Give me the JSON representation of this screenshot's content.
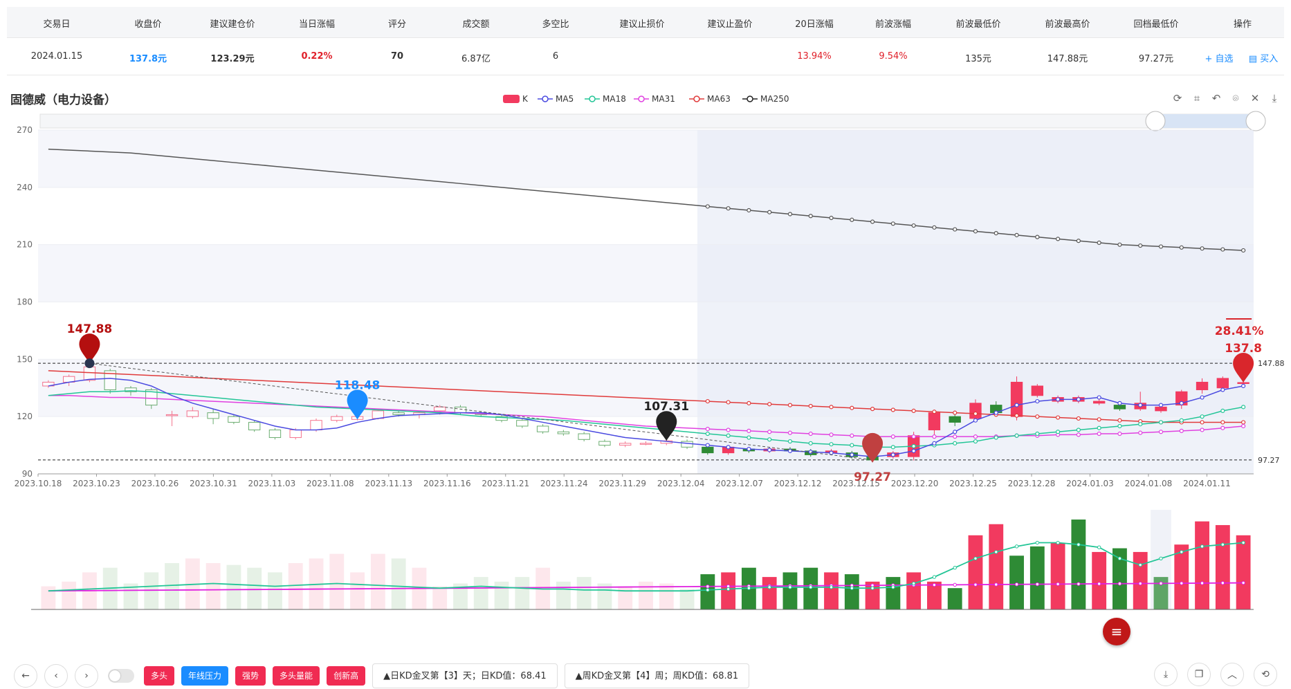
{
  "table": {
    "headers": [
      "交易日",
      "收盘价",
      "建议建仓价",
      "当日涨幅",
      "评分",
      "成交额",
      "多空比",
      "建议止损价",
      "建议止盈价",
      "20日涨幅",
      "前波涨幅",
      "前波最低价",
      "前波最高价",
      "回档最低价",
      "操作"
    ],
    "row": {
      "date": "2024.01.15",
      "close": "137.8元",
      "entry": "123.29元",
      "day_change": "0.22%",
      "score": "70",
      "turnover": "6.87亿",
      "ls_ratio": "6",
      "stop_loss": "",
      "take_profit": "",
      "change_20d": "13.94%",
      "wave_change": "9.54%",
      "wave_low": "135元",
      "wave_high": "147.88元",
      "pullback_low": "97.27元",
      "action_watch": "+ 自选",
      "action_buy": "▤ 买入"
    }
  },
  "chart_title": "固德威（电力设备）",
  "legend": [
    "K",
    "MA5",
    "MA18",
    "MA31",
    "MA63",
    "MA250"
  ],
  "colors": {
    "up": "#f23a5f",
    "down": "#2e8b35",
    "ma5": "#4a4ae0",
    "ma18": "#22c596",
    "ma31": "#e040e0",
    "ma63": "#e03a3a",
    "ma250": "#555555",
    "accent": "#1a8cff"
  },
  "chart_data": {
    "type": "candlestick",
    "ylim": [
      90,
      270
    ],
    "yticks": [
      "270",
      "240",
      "210",
      "180",
      "150",
      "120",
      "90"
    ],
    "xticks": [
      "2023.10.18",
      "2023.10.23",
      "2023.10.26",
      "2023.10.31",
      "2023.11.03",
      "2023.11.08",
      "2023.11.13",
      "2023.11.16",
      "2023.11.21",
      "2023.11.24",
      "2023.11.29",
      "2023.12.04",
      "2023.12.07",
      "2023.12.12",
      "2023.12.15",
      "2023.12.20",
      "2023.12.25",
      "2023.12.28",
      "2024.01.03",
      "2024.01.08",
      "2024.01.11"
    ],
    "candles": [
      [
        136,
        138,
        135,
        139
      ],
      [
        138,
        141,
        136,
        142
      ],
      [
        139,
        146,
        138,
        147.88
      ],
      [
        144,
        134,
        132,
        145
      ],
      [
        135,
        133,
        131,
        136
      ],
      [
        134,
        126,
        124,
        135
      ],
      [
        121,
        121,
        115,
        123
      ],
      [
        120,
        123,
        119,
        125
      ],
      [
        122,
        119,
        116,
        124
      ],
      [
        120,
        117,
        116,
        121
      ],
      [
        117,
        113,
        112,
        118
      ],
      [
        113,
        109,
        108,
        114
      ],
      [
        109,
        113,
        108,
        114
      ],
      [
        113,
        118,
        112,
        119
      ],
      [
        118,
        120,
        117,
        121
      ],
      [
        118.5,
        120,
        118,
        121
      ],
      [
        119,
        123,
        118.48,
        124
      ],
      [
        122,
        121,
        120,
        123
      ],
      [
        121,
        122,
        119,
        123
      ],
      [
        123,
        125,
        121,
        126
      ],
      [
        125,
        122,
        121,
        126
      ],
      [
        122,
        121,
        120,
        123
      ],
      [
        120,
        118,
        117,
        121
      ],
      [
        118,
        115,
        114,
        119
      ],
      [
        115,
        112,
        111,
        116
      ],
      [
        112,
        111,
        110,
        113
      ],
      [
        111,
        108,
        107,
        112
      ],
      [
        107,
        105,
        104,
        108
      ],
      [
        105,
        106,
        104,
        107
      ],
      [
        106,
        106,
        105,
        107
      ],
      [
        106,
        107.31,
        105,
        108
      ],
      [
        107,
        104,
        103,
        108
      ],
      [
        104,
        101,
        100,
        105
      ],
      [
        101,
        104,
        100,
        105
      ],
      [
        103,
        102,
        101,
        104
      ],
      [
        102,
        103,
        101,
        104
      ],
      [
        103,
        102,
        101,
        104
      ],
      [
        102,
        100,
        99,
        103
      ],
      [
        101,
        102,
        100,
        103
      ],
      [
        101,
        99,
        98,
        102
      ],
      [
        99,
        97.27,
        97.27,
        103
      ],
      [
        99,
        101,
        98,
        102
      ],
      [
        99,
        110,
        97,
        112
      ],
      [
        113,
        122,
        110,
        123
      ],
      [
        120,
        117,
        115,
        123
      ],
      [
        119,
        127,
        118,
        129
      ],
      [
        126,
        122,
        121,
        128
      ],
      [
        120,
        138,
        118,
        141
      ],
      [
        131,
        136,
        130,
        137
      ],
      [
        128,
        130,
        127,
        131
      ],
      [
        128,
        130,
        127,
        131
      ],
      [
        127,
        128,
        126,
        129
      ],
      [
        126,
        124,
        123,
        127
      ],
      [
        124,
        127,
        123,
        133
      ],
      [
        123,
        125,
        122,
        126
      ],
      [
        126,
        133,
        124,
        134
      ],
      [
        134,
        138,
        132,
        140
      ],
      [
        135,
        140,
        133,
        141
      ],
      [
        137.5,
        137.8,
        137,
        139
      ]
    ],
    "ma5": [
      136,
      138,
      139.5,
      140,
      139,
      136,
      131,
      127,
      124,
      121,
      118,
      115,
      113,
      113,
      114,
      117,
      119,
      120.5,
      121,
      121.5,
      122,
      122,
      121,
      119,
      117,
      115,
      113,
      111,
      109,
      108,
      107,
      106,
      105,
      104,
      103,
      102.5,
      102,
      101.5,
      101,
      100,
      99,
      100,
      102,
      106,
      112,
      118,
      122,
      126,
      128,
      129,
      129,
      130,
      127,
      126,
      126,
      127,
      130,
      134,
      136
    ],
    "ma18": [
      131,
      132,
      133,
      133,
      133.5,
      133,
      132,
      131,
      130,
      129,
      128,
      127,
      126,
      125,
      124.5,
      124,
      123.5,
      123,
      122.5,
      122,
      121,
      120,
      119.5,
      119,
      118.5,
      118,
      117,
      116,
      115,
      114,
      113,
      112,
      111,
      110,
      109,
      108,
      107,
      106,
      105.5,
      105,
      104,
      104,
      104.5,
      105,
      106,
      107,
      109,
      110,
      111,
      112,
      113,
      114,
      115,
      116,
      117,
      118,
      120,
      123,
      125
    ],
    "ma31": [
      131,
      131,
      130.5,
      130,
      130,
      129.5,
      129,
      128.5,
      128,
      127.5,
      127,
      126.5,
      126,
      125.5,
      125,
      124.5,
      124,
      123.5,
      123,
      122.5,
      122,
      121.5,
      121,
      120.5,
      120,
      119,
      118,
      117,
      116,
      115,
      114.5,
      114,
      113.5,
      113,
      112.5,
      112,
      111.5,
      111,
      110.5,
      110,
      109.5,
      109.5,
      109.5,
      109.5,
      109.5,
      109.5,
      109.5,
      110,
      110,
      110.5,
      110.5,
      111,
      111,
      111.5,
      112,
      112.5,
      113,
      114,
      115
    ],
    "ma63": [
      144,
      143.5,
      143,
      142.5,
      142,
      141.5,
      141,
      140.5,
      140,
      139.5,
      139,
      138.5,
      138,
      137.5,
      137,
      136.5,
      136,
      135.5,
      135,
      134.5,
      134,
      133.5,
      133,
      132.5,
      132,
      131.5,
      131,
      130.5,
      130,
      129.5,
      129,
      128.5,
      128,
      127.5,
      127,
      126.5,
      126,
      125.5,
      125,
      124.5,
      124,
      123.5,
      123,
      122.5,
      122,
      121.5,
      121,
      120.5,
      120,
      119.5,
      119,
      118.5,
      118,
      117.5,
      117,
      117,
      117,
      117,
      117
    ],
    "ma250": [
      260,
      259.5,
      259,
      258.5,
      258,
      257,
      256,
      255,
      254,
      253,
      252,
      251,
      250,
      249,
      248,
      247,
      246,
      245,
      244,
      243,
      242,
      241,
      240,
      239,
      238,
      237,
      236,
      235,
      234,
      233,
      232,
      231,
      230,
      229,
      228,
      227,
      226,
      225,
      224,
      223,
      222,
      221,
      220,
      219,
      218,
      217,
      216,
      215,
      214,
      213,
      212,
      211,
      210,
      209.5,
      209,
      208.5,
      208,
      207.5,
      207
    ],
    "volume": [
      25,
      30,
      40,
      45,
      28,
      40,
      50,
      55,
      50,
      48,
      45,
      40,
      50,
      55,
      60,
      40,
      60,
      55,
      45,
      25,
      28,
      35,
      30,
      35,
      45,
      30,
      35,
      28,
      25,
      30,
      28,
      22,
      38,
      40,
      45,
      35,
      40,
      45,
      40,
      38,
      30,
      35,
      40,
      30,
      23,
      80,
      92,
      58,
      68,
      72,
      97,
      62,
      66,
      62,
      35,
      70,
      95,
      91,
      80
    ],
    "vol_up": [
      true,
      true,
      true,
      false,
      false,
      false,
      false,
      true,
      true,
      false,
      false,
      false,
      true,
      true,
      true,
      true,
      true,
      false,
      true,
      true,
      false,
      false,
      false,
      false,
      true,
      false,
      false,
      false,
      true,
      true,
      true,
      false,
      false,
      true,
      false,
      true,
      false,
      false,
      true,
      false,
      true,
      false,
      true,
      true,
      false,
      true,
      true,
      false,
      false,
      true,
      false,
      true,
      false,
      true,
      false,
      true,
      true,
      true,
      true
    ],
    "markers": [
      {
        "label": "147.88",
        "color": "#b40f0f"
      },
      {
        "label": "118.48",
        "color": "#1a8cff"
      },
      {
        "label": "107.31",
        "color": "#222222"
      },
      {
        "label": "97.27",
        "color": "#c04040"
      },
      {
        "label": "137.8",
        "color": "#d9262c"
      }
    ],
    "last_pct": "28.41%",
    "hline_labels": [
      "147.88",
      "97.27"
    ]
  },
  "bottom": {
    "tags": [
      {
        "label": "多头",
        "style": "red"
      },
      {
        "label": "年线压力",
        "style": "blue"
      },
      {
        "label": "强势",
        "style": "red"
      },
      {
        "label": "多头量能",
        "style": "red"
      },
      {
        "label": "创新高",
        "style": "red"
      }
    ],
    "info1": "▲日KD金叉第【3】天；日KD值：68.41",
    "info2": "▲周KD金叉第【4】周；周KD值：68.81"
  }
}
